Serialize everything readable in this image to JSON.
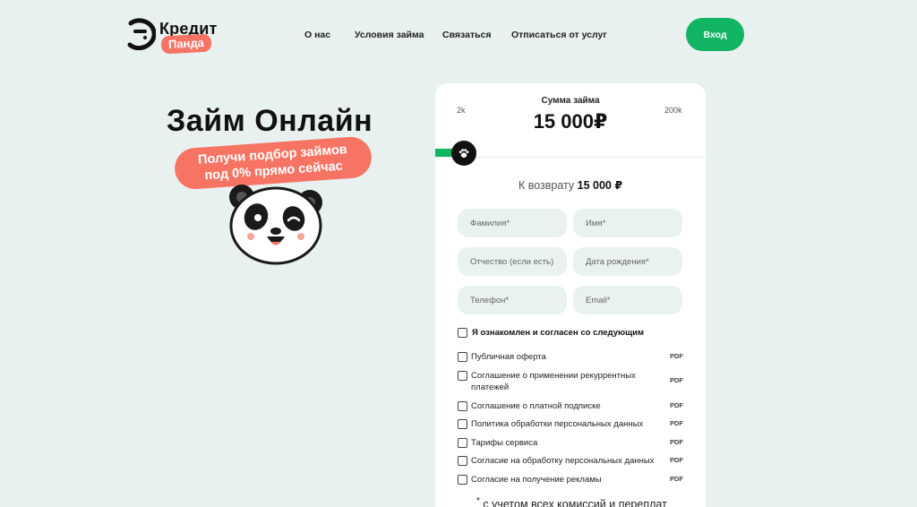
{
  "header": {
    "logo_word": "Кредит",
    "logo_badge": "Панда",
    "nav": [
      "О нас",
      "Условия займа",
      "Связаться",
      "Отписаться от услуг"
    ],
    "login_label": "Вход"
  },
  "hero": {
    "title": "Займ Онлайн",
    "badge_line1": "Получи подбор займов",
    "badge_line2": "под 0% прямо сейчас"
  },
  "form": {
    "sum_label": "Сумма займа",
    "sum_value": "15 000₽",
    "range_min": "2k",
    "range_max": "200k",
    "slider_level": 0.07,
    "return_prefix": "К возврату",
    "return_value": "15 000 ₽",
    "fields": {
      "last_name": "Фамилия*",
      "first_name": "Имя*",
      "patronymic": "Отчество (если есть)",
      "birth_date": "Дата рождения*",
      "phone": "Телефон*",
      "email": "Email*"
    },
    "agree_main": "Я ознакомлен и согласен со следующим",
    "documents": [
      {
        "label": "Публичная оферта",
        "tag": "PDF"
      },
      {
        "label": "Соглашение о применении рекуррентных платежей",
        "tag": "PDF"
      },
      {
        "label": "Соглашение о платной подписке",
        "tag": "PDF"
      },
      {
        "label": "Политика обработки персональных данных",
        "tag": "PDF"
      },
      {
        "label": "Тарифы сервиса",
        "tag": "PDF"
      },
      {
        "label": "Согласие на обработку персональных данных",
        "tag": "PDF"
      },
      {
        "label": "Согласие на получение рекламы",
        "tag": "PDF"
      }
    ],
    "footnote_mark": "*",
    "footnote": "с учетом всех комиссий и переплат"
  },
  "colors": {
    "accent_green": "#10b463",
    "accent_coral": "#f77464",
    "background": "#e8f0f0"
  }
}
